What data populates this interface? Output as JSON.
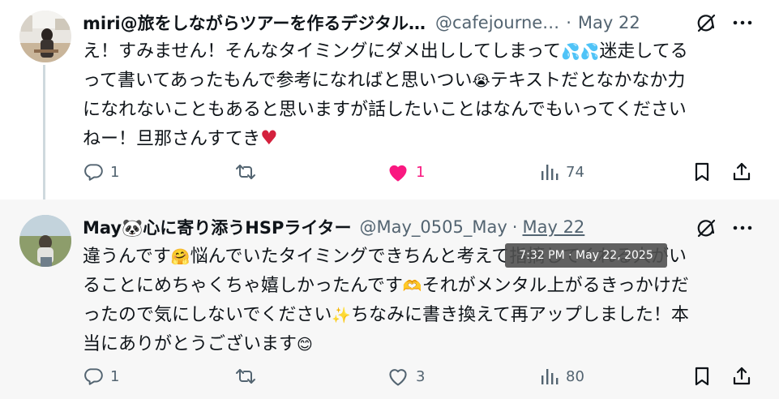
{
  "tweets": [
    {
      "display_name": "miri@旅をしながらツアーを作るデジタル…",
      "handle": "@cafejourne…",
      "separator": "·",
      "date": "May 22",
      "lines": [
        [
          "え！すみません！そんなタイミングにダメ出ししてしまって",
          "💦💦",
          "迷走してる"
        ],
        [
          "って書いてあったもんで参考になればと思いつい",
          "😭",
          "テキストだとなかなか力"
        ],
        [
          "になれないこともあると思いますが話したいことはなんでもいってください"
        ],
        [
          "ねー！旦那さんすてき",
          "♥"
        ]
      ],
      "actions": {
        "replies": "1",
        "likes": "1",
        "views": "74"
      },
      "liked": true
    },
    {
      "display_name": "May🐼心に寄り添うHSPライター",
      "handle": "@May_0505_May",
      "separator": "·",
      "date": "May 22",
      "lines": [
        [
          "違うんです",
          "🤗",
          "悩んでいたタイミングできちんと考えて指摘してくれる人がい"
        ],
        [
          "ることにめちゃくちゃ嬉しかったんです",
          "🫶",
          "それがメンタル上がるきっかけだ"
        ],
        [
          "ったので気にしないでください",
          "✨",
          "ちなみに書き換えて再アップしました！本"
        ],
        [
          "当にありがとうございます",
          "😊"
        ]
      ],
      "actions": {
        "replies": "1",
        "likes": "3",
        "views": "80"
      },
      "liked": false
    }
  ],
  "tooltip": "7:32 PM · May 22, 2025",
  "colors": {
    "text": "#0f1419",
    "secondary": "#536471",
    "like_pink": "#f91880",
    "thread_line": "#cfd9de",
    "hover_bg": "#f7f7f7"
  },
  "icons": [
    "reply-icon",
    "retweet-icon",
    "like-icon",
    "views-icon",
    "bookmark-icon",
    "share-icon",
    "grok-icon",
    "more-icon"
  ]
}
